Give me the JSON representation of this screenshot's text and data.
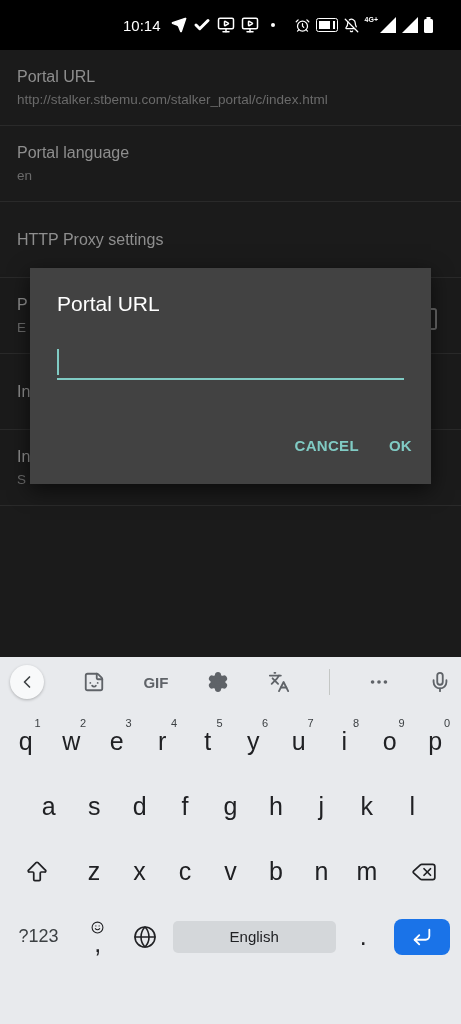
{
  "status_bar": {
    "time": "10:14",
    "network": "4G+"
  },
  "settings": [
    {
      "title": "Portal URL",
      "subtitle": "http://stalker.stbemu.com/stalker_portal/c/index.html"
    },
    {
      "title": "Portal language",
      "subtitle": "en"
    },
    {
      "title": "HTTP Proxy settings"
    },
    {
      "title": "P",
      "subtitle": "E",
      "kind": "checkbox",
      "checked": false
    },
    {
      "title": "In"
    },
    {
      "title": "In",
      "subtitle": "S"
    }
  ],
  "dialog": {
    "title": "Portal URL",
    "field": {
      "focused": true
    },
    "buttons": [
      "CANCEL",
      "OK"
    ]
  },
  "keyboard": {
    "toolbar": {
      "gif": "GIF"
    },
    "rows": [
      {
        "keys": [
          {
            "label": "q",
            "hint": "1"
          },
          {
            "label": "w",
            "hint": "2"
          },
          {
            "label": "e",
            "hint": "3"
          },
          {
            "label": "r",
            "hint": "4"
          },
          {
            "label": "t",
            "hint": "5"
          },
          {
            "label": "y",
            "hint": "6"
          },
          {
            "label": "u",
            "hint": "7"
          },
          {
            "label": "i",
            "hint": "8"
          },
          {
            "label": "o",
            "hint": "9"
          },
          {
            "label": "p",
            "hint": "0"
          }
        ]
      },
      {
        "keys": [
          {
            "label": "a"
          },
          {
            "label": "s"
          },
          {
            "label": "d"
          },
          {
            "label": "f"
          },
          {
            "label": "g"
          },
          {
            "label": "h"
          },
          {
            "label": "j"
          },
          {
            "label": "k"
          },
          {
            "label": "l"
          }
        ]
      },
      {
        "keys": [
          {
            "kind": "shift"
          },
          {
            "label": "z"
          },
          {
            "label": "x"
          },
          {
            "label": "c"
          },
          {
            "label": "v"
          },
          {
            "label": "b"
          },
          {
            "label": "n"
          },
          {
            "label": "m"
          },
          {
            "kind": "backspace"
          }
        ]
      },
      {
        "keys": [
          {
            "kind": "symbols",
            "label": "?123"
          },
          {
            "kind": "comma",
            "label": ","
          },
          {
            "kind": "globe"
          },
          {
            "kind": "space",
            "label": "English"
          },
          {
            "kind": "period",
            "label": "."
          },
          {
            "kind": "enter"
          }
        ]
      }
    ]
  }
}
